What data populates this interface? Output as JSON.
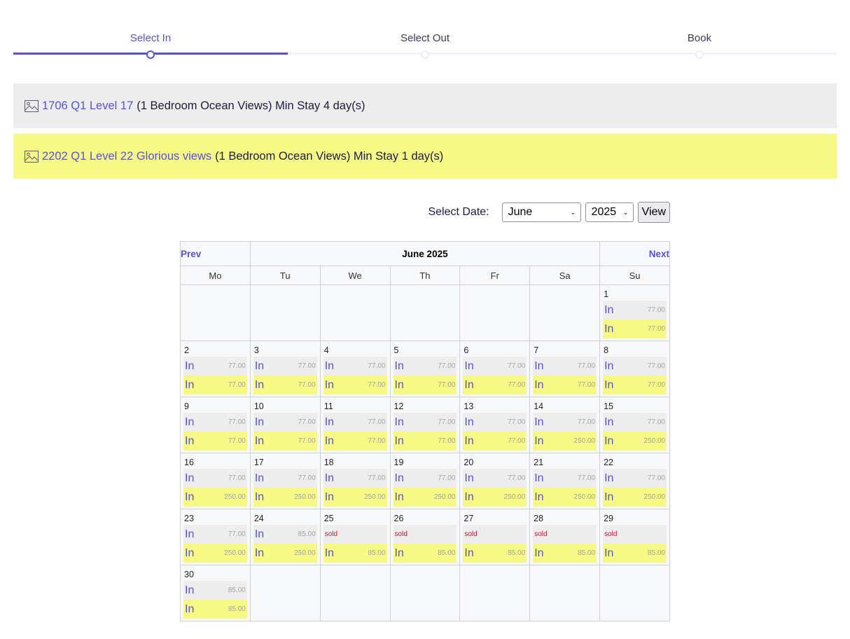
{
  "stepper": {
    "steps": [
      {
        "label": "Select In",
        "active": true
      },
      {
        "label": "Select Out",
        "active": false
      },
      {
        "label": "Book",
        "active": false
      }
    ]
  },
  "properties": [
    {
      "link": "1706 Q1 Level 17",
      "desc": "(1 Bedroom Ocean Views) Min Stay 4 day(s)",
      "color": "#ededee"
    },
    {
      "link": "2202 Q1 Level 22 Glorious views",
      "desc": "(1 Bedroom Ocean Views) Min Stay 1 day(s)",
      "color": "#f7f985"
    }
  ],
  "select_date": {
    "label": "Select Date:",
    "month": "June",
    "year": "2025",
    "view_label": "View"
  },
  "calendar": {
    "prev": "Prev",
    "next": "Next",
    "title": "June 2025",
    "weekdays": [
      "Mo",
      "Tu",
      "We",
      "Th",
      "Fr",
      "Sa",
      "Su"
    ],
    "in_label": "In",
    "sold_label": "sold",
    "weeks": [
      [
        null,
        null,
        null,
        null,
        null,
        null,
        {
          "day": "1",
          "slots": [
            {
              "status": "in",
              "price": "77.00"
            },
            {
              "status": "in",
              "price": "77.00"
            }
          ]
        }
      ],
      [
        {
          "day": "2",
          "slots": [
            {
              "status": "in",
              "price": "77.00"
            },
            {
              "status": "in",
              "price": "77.00"
            }
          ]
        },
        {
          "day": "3",
          "slots": [
            {
              "status": "in",
              "price": "77.00"
            },
            {
              "status": "in",
              "price": "77.00"
            }
          ]
        },
        {
          "day": "4",
          "slots": [
            {
              "status": "in",
              "price": "77.00"
            },
            {
              "status": "in",
              "price": "77.00"
            }
          ]
        },
        {
          "day": "5",
          "slots": [
            {
              "status": "in",
              "price": "77.00"
            },
            {
              "status": "in",
              "price": "77.00"
            }
          ]
        },
        {
          "day": "6",
          "slots": [
            {
              "status": "in",
              "price": "77.00"
            },
            {
              "status": "in",
              "price": "77.00"
            }
          ]
        },
        {
          "day": "7",
          "slots": [
            {
              "status": "in",
              "price": "77.00"
            },
            {
              "status": "in",
              "price": "77.00"
            }
          ]
        },
        {
          "day": "8",
          "slots": [
            {
              "status": "in",
              "price": "77.00"
            },
            {
              "status": "in",
              "price": "77.00"
            }
          ]
        }
      ],
      [
        {
          "day": "9",
          "slots": [
            {
              "status": "in",
              "price": "77.00"
            },
            {
              "status": "in",
              "price": "77.00"
            }
          ]
        },
        {
          "day": "10",
          "slots": [
            {
              "status": "in",
              "price": "77.00"
            },
            {
              "status": "in",
              "price": "77.00"
            }
          ]
        },
        {
          "day": "11",
          "slots": [
            {
              "status": "in",
              "price": "77.00"
            },
            {
              "status": "in",
              "price": "77.00"
            }
          ]
        },
        {
          "day": "12",
          "slots": [
            {
              "status": "in",
              "price": "77.00"
            },
            {
              "status": "in",
              "price": "77.00"
            }
          ]
        },
        {
          "day": "13",
          "slots": [
            {
              "status": "in",
              "price": "77.00"
            },
            {
              "status": "in",
              "price": "77.00"
            }
          ]
        },
        {
          "day": "14",
          "slots": [
            {
              "status": "in",
              "price": "77.00"
            },
            {
              "status": "in",
              "price": "250.00"
            }
          ]
        },
        {
          "day": "15",
          "slots": [
            {
              "status": "in",
              "price": "77.00"
            },
            {
              "status": "in",
              "price": "250.00"
            }
          ]
        }
      ],
      [
        {
          "day": "16",
          "slots": [
            {
              "status": "in",
              "price": "77.00"
            },
            {
              "status": "in",
              "price": "250.00"
            }
          ]
        },
        {
          "day": "17",
          "slots": [
            {
              "status": "in",
              "price": "77.00"
            },
            {
              "status": "in",
              "price": "250.00"
            }
          ]
        },
        {
          "day": "18",
          "slots": [
            {
              "status": "in",
              "price": "77.00"
            },
            {
              "status": "in",
              "price": "250.00"
            }
          ]
        },
        {
          "day": "19",
          "slots": [
            {
              "status": "in",
              "price": "77.00"
            },
            {
              "status": "in",
              "price": "250.00"
            }
          ]
        },
        {
          "day": "20",
          "slots": [
            {
              "status": "in",
              "price": "77.00"
            },
            {
              "status": "in",
              "price": "250.00"
            }
          ]
        },
        {
          "day": "21",
          "slots": [
            {
              "status": "in",
              "price": "77.00"
            },
            {
              "status": "in",
              "price": "250.00"
            }
          ]
        },
        {
          "day": "22",
          "slots": [
            {
              "status": "in",
              "price": "77.00"
            },
            {
              "status": "in",
              "price": "250.00"
            }
          ]
        }
      ],
      [
        {
          "day": "23",
          "slots": [
            {
              "status": "in",
              "price": "77.00"
            },
            {
              "status": "in",
              "price": "250.00"
            }
          ]
        },
        {
          "day": "24",
          "slots": [
            {
              "status": "in",
              "price": "85.00"
            },
            {
              "status": "in",
              "price": "250.00"
            }
          ]
        },
        {
          "day": "25",
          "slots": [
            {
              "status": "sold"
            },
            {
              "status": "in",
              "price": "85.00"
            }
          ]
        },
        {
          "day": "26",
          "slots": [
            {
              "status": "sold"
            },
            {
              "status": "in",
              "price": "85.00"
            }
          ]
        },
        {
          "day": "27",
          "slots": [
            {
              "status": "sold"
            },
            {
              "status": "in",
              "price": "85.00"
            }
          ]
        },
        {
          "day": "28",
          "slots": [
            {
              "status": "sold"
            },
            {
              "status": "in",
              "price": "85.00"
            }
          ]
        },
        {
          "day": "29",
          "slots": [
            {
              "status": "sold"
            },
            {
              "status": "in",
              "price": "85.00"
            }
          ]
        }
      ],
      [
        {
          "day": "30",
          "slots": [
            {
              "status": "in",
              "price": "85.00"
            },
            {
              "status": "in",
              "price": "85.00"
            }
          ]
        },
        null,
        null,
        null,
        null,
        null,
        null
      ]
    ]
  },
  "colors": {
    "accent": "#5851db",
    "property_1_bg": "#ededee",
    "property_2_bg": "#f7f985",
    "sold": "#cc1133"
  }
}
